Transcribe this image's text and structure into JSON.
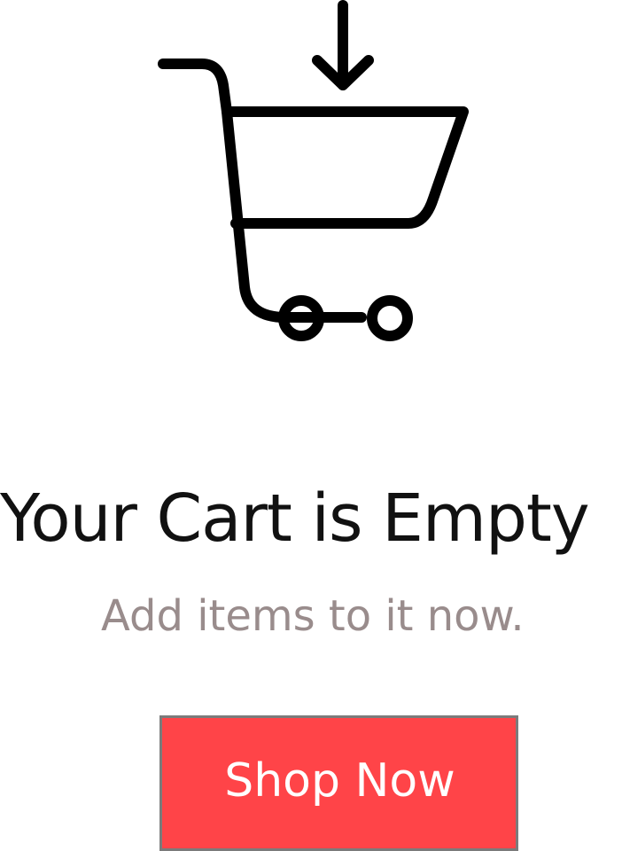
{
  "empty_state": {
    "icon": "cart-download-icon",
    "title": "Your Cart is Empty",
    "subtitle": "Add items to it now.",
    "button_label": "Shop Now"
  },
  "colors": {
    "title_text": "#111111",
    "subtitle_text": "#998c8c",
    "button_background": "#ff4448",
    "button_border": "#7b7b7b",
    "button_text": "#ffffff",
    "icon_stroke": "#000000"
  }
}
